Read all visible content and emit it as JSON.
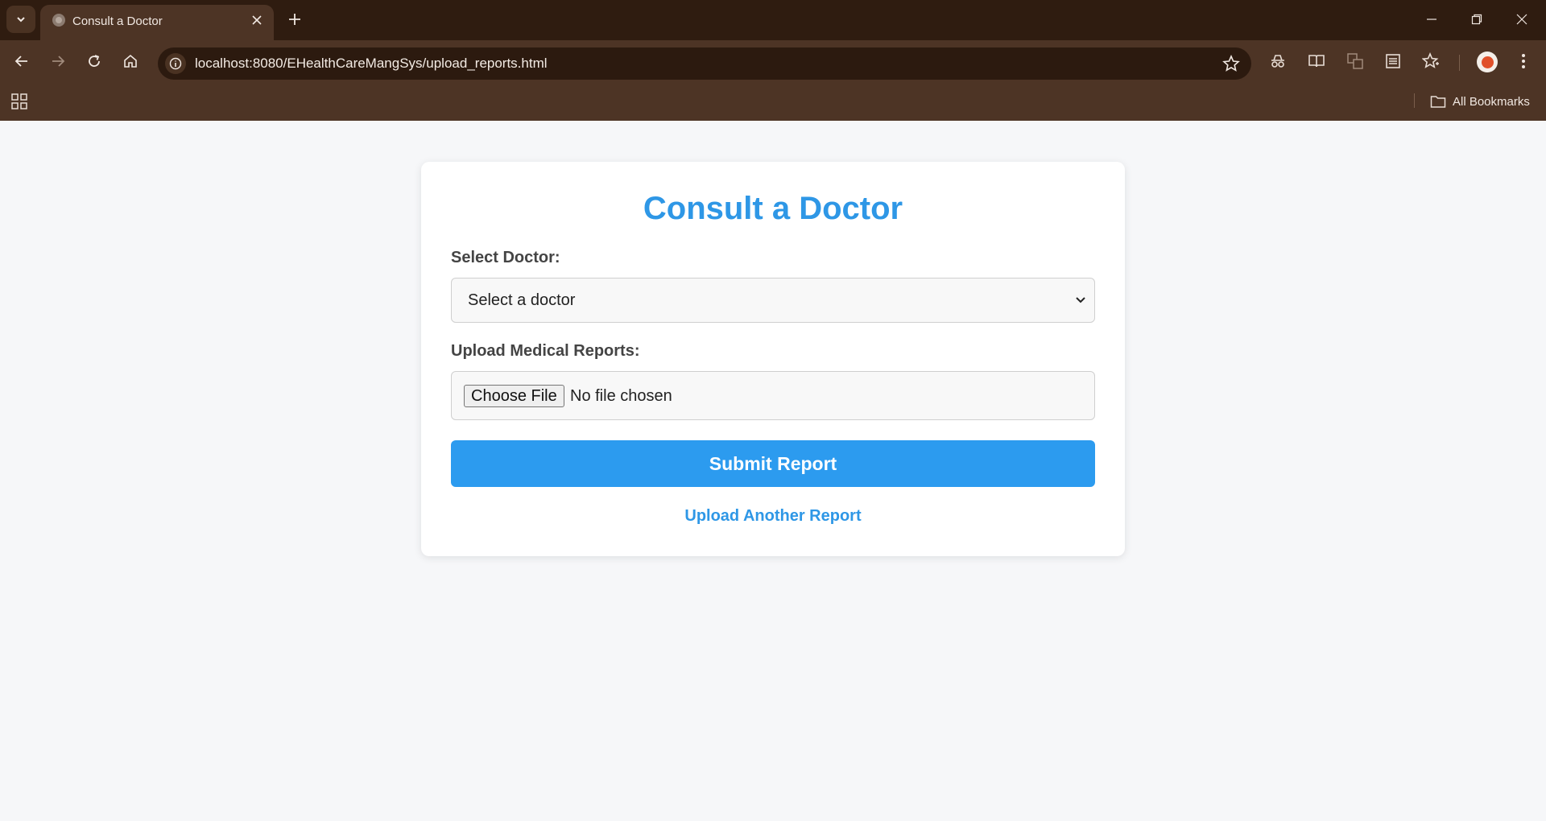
{
  "browser": {
    "tab_title": "Consult a Doctor",
    "url": "localhost:8080/EHealthCareMangSys/upload_reports.html",
    "bookmarks_label": "All Bookmarks",
    "chrome_color": "#4d3425",
    "titlebar_color": "#2f1c10",
    "icons": [
      "tab-search-icon",
      "globe-icon",
      "close-icon",
      "plus-icon",
      "minimize-icon",
      "restore-icon",
      "window-close-icon",
      "back-icon",
      "forward-icon",
      "reload-icon",
      "home-icon",
      "info-icon",
      "star-icon",
      "incognito-icon",
      "reader-mode-icon",
      "translate-icon",
      "reading-list-icon",
      "favorites-icon",
      "avatar",
      "more-menu-icon",
      "apps-grid-icon",
      "folder-icon"
    ]
  },
  "page": {
    "title": "Consult a Doctor",
    "accent_color": "#2e97e6",
    "select_doctor_label": "Select Doctor:",
    "select_doctor_value": "Select a doctor",
    "upload_label": "Upload Medical Reports:",
    "choose_file_label": "Choose File",
    "no_file_text": "No file chosen",
    "submit_label": "Submit Report",
    "upload_another_label": "Upload Another Report"
  }
}
